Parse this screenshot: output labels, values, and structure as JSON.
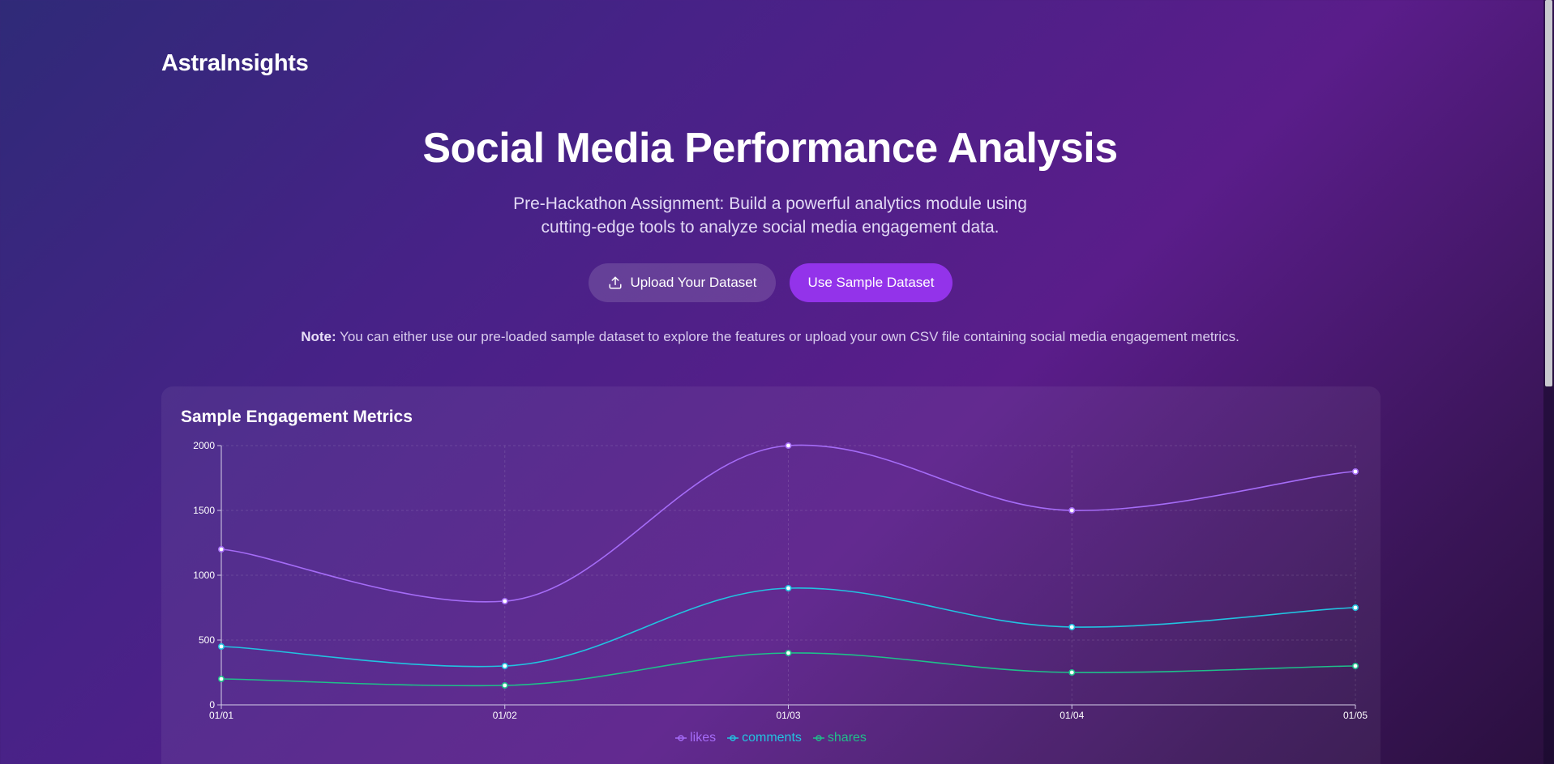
{
  "brand": "AstraInsights",
  "hero": {
    "title": "Social Media Performance Analysis",
    "subtitle": "Pre-Hackathon Assignment: Build a powerful analytics module using cutting-edge tools to analyze social media engagement data."
  },
  "buttons": {
    "upload_label": "Upload Your Dataset",
    "sample_label": "Use Sample Dataset"
  },
  "note": {
    "label": "Note:",
    "text": " You can either use our pre-loaded sample dataset to explore the features or upload your own CSV file containing social media engagement metrics."
  },
  "icons": {
    "upload": "upload-icon"
  },
  "colors": {
    "accent": "#9333ea",
    "likes": "#a56cf7",
    "comments": "#22c3e0",
    "shares": "#1fbf8a"
  },
  "chart_card": {
    "title": "Sample Engagement Metrics"
  },
  "chart_data": {
    "type": "line",
    "title": "Sample Engagement Metrics",
    "categories": [
      "01/01",
      "01/02",
      "01/03",
      "01/04",
      "01/05"
    ],
    "ylim": [
      0,
      2000
    ],
    "yticks": [
      "0",
      "500",
      "1000",
      "1500",
      "2000"
    ],
    "grid": true,
    "legend_position": "bottom",
    "series": [
      {
        "name": "likes",
        "color": "#a56cf7",
        "values": [
          1200,
          800,
          2000,
          1500,
          1800
        ]
      },
      {
        "name": "comments",
        "color": "#22c3e0",
        "values": [
          450,
          300,
          900,
          600,
          750
        ]
      },
      {
        "name": "shares",
        "color": "#1fbf8a",
        "values": [
          200,
          150,
          400,
          250,
          300
        ]
      }
    ]
  }
}
